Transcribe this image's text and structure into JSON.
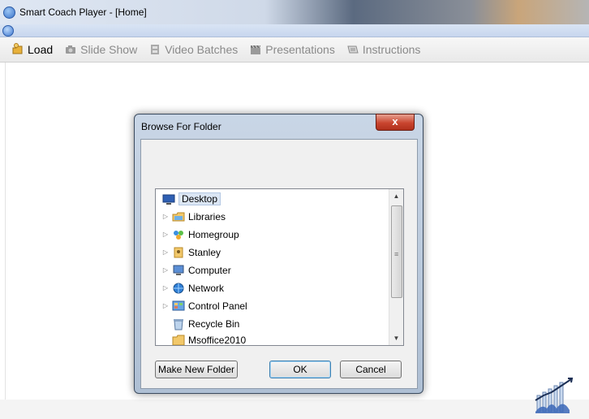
{
  "window": {
    "title": "Smart Coach Player - [Home]"
  },
  "toolbar": {
    "items": [
      {
        "label": "Load",
        "icon": "folder-hand-icon",
        "enabled": true
      },
      {
        "label": "Slide Show",
        "icon": "camera-icon",
        "enabled": false
      },
      {
        "label": "Video Batches",
        "icon": "film-icon",
        "enabled": false
      },
      {
        "label": "Presentations",
        "icon": "clapper-icon",
        "enabled": false
      },
      {
        "label": "Instructions",
        "icon": "document-icon",
        "enabled": false
      }
    ]
  },
  "dialog": {
    "title": "Browse For Folder",
    "close_label": "x",
    "tree_items": [
      {
        "label": "Desktop",
        "icon": "desktop-icon",
        "expandable": false,
        "selected": true
      },
      {
        "label": "Libraries",
        "icon": "libraries-icon",
        "expandable": true,
        "selected": false
      },
      {
        "label": "Homegroup",
        "icon": "homegroup-icon",
        "expandable": true,
        "selected": false
      },
      {
        "label": "Stanley",
        "icon": "user-folder-icon",
        "expandable": true,
        "selected": false
      },
      {
        "label": "Computer",
        "icon": "computer-icon",
        "expandable": true,
        "selected": false
      },
      {
        "label": "Network",
        "icon": "network-icon",
        "expandable": true,
        "selected": false
      },
      {
        "label": "Control Panel",
        "icon": "control-panel-icon",
        "expandable": true,
        "selected": false
      },
      {
        "label": "Recycle Bin",
        "icon": "recycle-bin-icon",
        "expandable": false,
        "selected": false
      },
      {
        "label": "Msoffice2010",
        "icon": "folder-icon",
        "expandable": false,
        "selected": false
      }
    ],
    "buttons": {
      "make_new_folder": "Make New Folder",
      "ok": "OK",
      "cancel": "Cancel"
    }
  },
  "colors": {
    "accent": "#3c7fb1",
    "close_button": "#c9452f",
    "selection": "#dbe6f4"
  }
}
